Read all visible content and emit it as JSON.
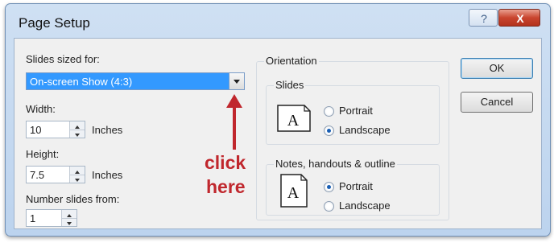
{
  "dialog": {
    "title": "Page Setup",
    "help_glyph": "?",
    "close_glyph": "X"
  },
  "slides_sized_for": {
    "label": "Slides sized for:",
    "value": "On-screen Show (4:3)"
  },
  "width": {
    "label": "Width:",
    "value": "10",
    "unit": "Inches"
  },
  "height": {
    "label": "Height:",
    "value": "7.5",
    "unit": "Inches"
  },
  "number_slides_from": {
    "label": "Number slides from:",
    "value": "1"
  },
  "annotation": {
    "line1": "click",
    "line2": "here",
    "color": "#c0272d"
  },
  "orientation": {
    "title": "Orientation",
    "slides": {
      "title": "Slides",
      "portrait_label": "Portrait",
      "landscape_label": "Landscape",
      "selected": "Landscape",
      "icon_letter": "A"
    },
    "notes": {
      "title": "Notes, handouts & outline",
      "portrait_label": "Portrait",
      "landscape_label": "Landscape",
      "selected": "Portrait",
      "icon_letter": "A"
    }
  },
  "buttons": {
    "ok": "OK",
    "cancel": "Cancel"
  },
  "colors": {
    "selection": "#3399ff",
    "arrow": "#c0272d",
    "close": "#c9452f"
  }
}
